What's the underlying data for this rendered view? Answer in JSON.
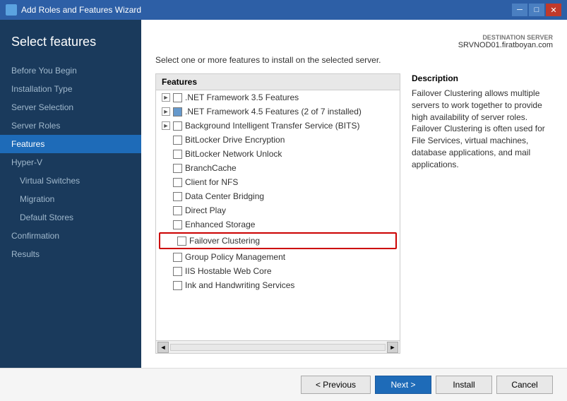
{
  "titleBar": {
    "title": "Add Roles and Features Wizard",
    "icon": "wizard-icon",
    "controls": {
      "minimize": "─",
      "maximize": "□",
      "close": "✕"
    }
  },
  "sidebar": {
    "header": "Select features",
    "items": [
      {
        "id": "before-you-begin",
        "label": "Before You Begin",
        "sub": false,
        "active": false
      },
      {
        "id": "installation-type",
        "label": "Installation Type",
        "sub": false,
        "active": false
      },
      {
        "id": "server-selection",
        "label": "Server Selection",
        "sub": false,
        "active": false
      },
      {
        "id": "server-roles",
        "label": "Server Roles",
        "sub": false,
        "active": false
      },
      {
        "id": "features",
        "label": "Features",
        "sub": false,
        "active": true
      },
      {
        "id": "hyper-v",
        "label": "Hyper-V",
        "sub": false,
        "active": false
      },
      {
        "id": "virtual-switches",
        "label": "Virtual Switches",
        "sub": true,
        "active": false
      },
      {
        "id": "migration",
        "label": "Migration",
        "sub": true,
        "active": false
      },
      {
        "id": "default-stores",
        "label": "Default Stores",
        "sub": true,
        "active": false
      },
      {
        "id": "confirmation",
        "label": "Confirmation",
        "sub": false,
        "active": false
      },
      {
        "id": "results",
        "label": "Results",
        "sub": false,
        "active": false
      }
    ]
  },
  "server": {
    "label": "DESTINATION SERVER",
    "name": "SRVNOD01.firatboyan.com"
  },
  "instruction": "Select one or more features to install on the selected server.",
  "featuresPanel": {
    "header": "Features",
    "items": [
      {
        "id": "net35",
        "label": ".NET Framework 3.5 Features",
        "hasExpand": true,
        "expandState": "►",
        "checkState": "none"
      },
      {
        "id": "net45",
        "label": ".NET Framework 4.5 Features (2 of 7 installed)",
        "hasExpand": true,
        "expandState": "►",
        "checkState": "partial"
      },
      {
        "id": "bits",
        "label": "Background Intelligent Transfer Service (BITS)",
        "hasExpand": true,
        "expandState": "►",
        "checkState": "none"
      },
      {
        "id": "bitlocker-drive",
        "label": "BitLocker Drive Encryption",
        "hasExpand": false,
        "checkState": "none"
      },
      {
        "id": "bitlocker-network",
        "label": "BitLocker Network Unlock",
        "hasExpand": false,
        "checkState": "none"
      },
      {
        "id": "branchcache",
        "label": "BranchCache",
        "hasExpand": false,
        "checkState": "none"
      },
      {
        "id": "client-nfs",
        "label": "Client for NFS",
        "hasExpand": false,
        "checkState": "none"
      },
      {
        "id": "dcb",
        "label": "Data Center Bridging",
        "hasExpand": false,
        "checkState": "none"
      },
      {
        "id": "direct-play",
        "label": "Direct Play",
        "hasExpand": false,
        "checkState": "none"
      },
      {
        "id": "enhanced-storage",
        "label": "Enhanced Storage",
        "hasExpand": false,
        "checkState": "none"
      },
      {
        "id": "failover-clustering",
        "label": "Failover Clustering",
        "hasExpand": false,
        "checkState": "none",
        "highlighted": true
      },
      {
        "id": "group-policy",
        "label": "Group Policy Management",
        "hasExpand": false,
        "checkState": "none"
      },
      {
        "id": "iis-hostable",
        "label": "IIS Hostable Web Core",
        "hasExpand": false,
        "checkState": "none"
      },
      {
        "id": "ink-handwriting",
        "label": "Ink and Handwriting Services",
        "hasExpand": false,
        "checkState": "none"
      }
    ]
  },
  "description": {
    "header": "Description",
    "text": "Failover Clustering allows multiple servers to work together to provide high availability of server roles. Failover Clustering is often used for File Services, virtual machines, database applications, and mail applications."
  },
  "footer": {
    "previousLabel": "< Previous",
    "nextLabel": "Next >",
    "installLabel": "Install",
    "cancelLabel": "Cancel"
  }
}
